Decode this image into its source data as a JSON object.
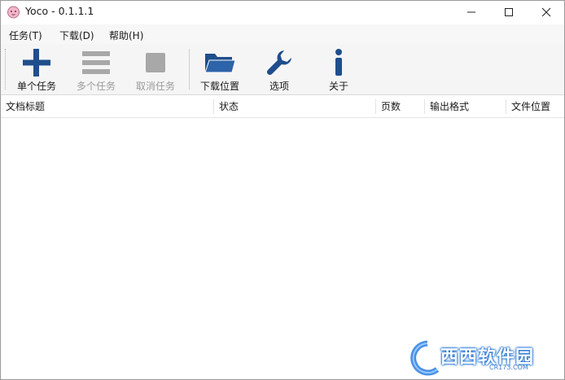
{
  "window": {
    "title": "Yoco - 0.1.1.1"
  },
  "menu": [
    {
      "label": "任务(T)"
    },
    {
      "label": "下载(D)"
    },
    {
      "label": "帮助(H)"
    }
  ],
  "toolbar": {
    "items": [
      {
        "label": "单个任务",
        "icon": "plus-icon",
        "enabled": true
      },
      {
        "label": "多个任务",
        "icon": "list-icon",
        "enabled": false
      },
      {
        "label": "取消任务",
        "icon": "stop-icon",
        "enabled": false
      },
      {
        "label": "下载位置",
        "icon": "folder-icon",
        "enabled": true
      },
      {
        "label": "选项",
        "icon": "wrench-icon",
        "enabled": true
      },
      {
        "label": "关于",
        "icon": "info-icon",
        "enabled": true
      }
    ]
  },
  "list": {
    "columns": [
      {
        "label": "文档标题"
      },
      {
        "label": "状态"
      },
      {
        "label": "页数"
      },
      {
        "label": "输出格式"
      },
      {
        "label": "文件位置"
      }
    ],
    "rows": []
  },
  "watermark": {
    "text": "西西软件园",
    "sub": "CR173.COM"
  },
  "colors": {
    "icon_blue": "#1f4e8c",
    "icon_disabled": "#a8a8a8"
  }
}
